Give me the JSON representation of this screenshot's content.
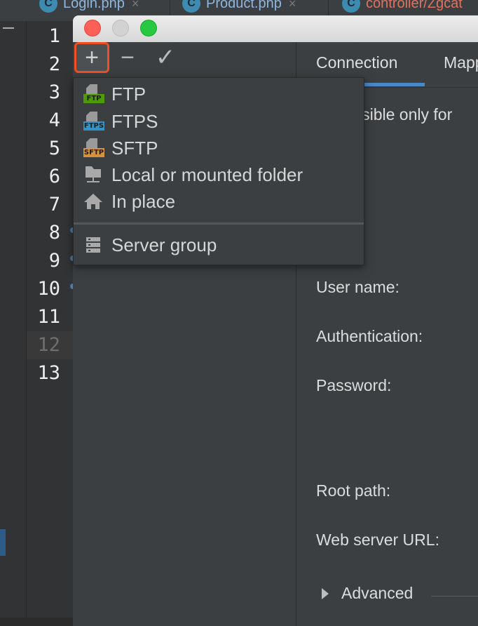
{
  "editor": {
    "tabs": [
      {
        "label": "Login.php",
        "icon": "C",
        "close": "×"
      },
      {
        "label": "Product.php",
        "icon": "C",
        "close": "×"
      },
      {
        "label": "controller/Zgcat",
        "icon": "C"
      }
    ],
    "line_numbers": [
      "1",
      "2",
      "3",
      "4",
      "5",
      "6",
      "7",
      "8",
      "9",
      "10",
      "11",
      "12",
      "13"
    ],
    "current_line": "12"
  },
  "dialog": {
    "toolbar": {
      "add_symbol": "+",
      "remove_symbol": "−",
      "apply_symbol": "✓"
    },
    "connection_tabs": [
      {
        "label": "Connection",
        "active": true
      },
      {
        "label": "Mapp",
        "active": false
      }
    ],
    "visible_only_text": "isible only for",
    "form": {
      "user_name_label": "User name:",
      "authentication_label": "Authentication:",
      "password_label": "Password:",
      "root_path_label": "Root path:",
      "web_server_url_label": "Web server URL:",
      "advanced_label": "Advanced"
    }
  },
  "add_menu": {
    "items": [
      {
        "label": "FTP",
        "icon": "ftp-server-icon",
        "badge": "FTP",
        "badge_color": "#4e9a06"
      },
      {
        "label": "FTPS",
        "icon": "ftps-server-icon",
        "badge": "FTPS",
        "badge_color": "#3592c4"
      },
      {
        "label": "SFTP",
        "icon": "sftp-server-icon",
        "badge": "SFTP",
        "badge_color": "#d9923b"
      },
      {
        "label": "Local or mounted folder",
        "icon": "folder-icon"
      },
      {
        "label": "In place",
        "icon": "home-icon"
      }
    ],
    "group_item": {
      "label": "Server group",
      "icon": "server-group-icon"
    }
  },
  "colors": {
    "highlight_border": "#f04e23",
    "tab_underline": "#4a88c7",
    "close_button": "#fe5f57",
    "maximize_button": "#28c840"
  }
}
